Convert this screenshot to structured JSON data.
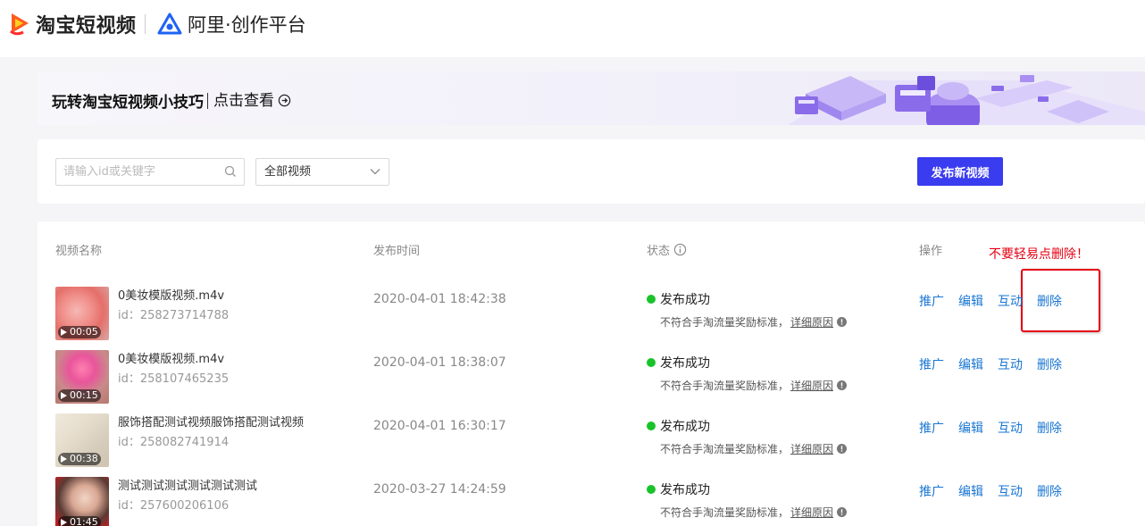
{
  "header": {
    "brand1": "淘宝短视频",
    "brand2": "阿里·创作平台"
  },
  "banner": {
    "title": "玩转淘宝短视频小技巧",
    "link": "点击查看"
  },
  "filter": {
    "search_placeholder": "请输入id或关键字",
    "select_value": "全部视频",
    "publish_button": "发布新视频"
  },
  "table": {
    "columns": [
      "视频名称",
      "发布时间",
      "状态",
      "操作"
    ],
    "warning": "不要轻易点删除！",
    "rows": [
      {
        "duration": "00:05",
        "name": "0美妆模版视频.m4v",
        "id": "id：258273714788",
        "time": "2020-04-01 18:42:38",
        "status": "发布成功",
        "note": "不符合手淘流量奖励标准，",
        "detail": "详细原因",
        "ops": [
          "推广",
          "编辑",
          "互动",
          "删除"
        ]
      },
      {
        "duration": "00:15",
        "name": "0美妆模版视频.m4v",
        "id": "id：258107465235",
        "time": "2020-04-01 18:38:07",
        "status": "发布成功",
        "note": "不符合手淘流量奖励标准，",
        "detail": "详细原因",
        "ops": [
          "推广",
          "编辑",
          "互动",
          "删除"
        ]
      },
      {
        "duration": "00:38",
        "name": "服饰搭配测试视频服饰搭配测试视频",
        "id": "id：258082741914",
        "time": "2020-04-01 16:30:17",
        "status": "发布成功",
        "note": "不符合手淘流量奖励标准，",
        "detail": "详细原因",
        "ops": [
          "推广",
          "编辑",
          "互动",
          "删除"
        ]
      },
      {
        "duration": "01:45",
        "name": "测试测试测试测试测试测试",
        "id": "id：257600206106",
        "time": "2020-03-27 14:24:59",
        "status": "发布成功",
        "note": "不符合手淘流量奖励标准，",
        "detail": "详细原因",
        "ops": [
          "推广",
          "编辑",
          "互动",
          "删除"
        ]
      }
    ]
  },
  "colors": {
    "accent": "#3a3cf0",
    "link": "#1976d2",
    "success": "#19c32b",
    "warning": "#e60012"
  }
}
